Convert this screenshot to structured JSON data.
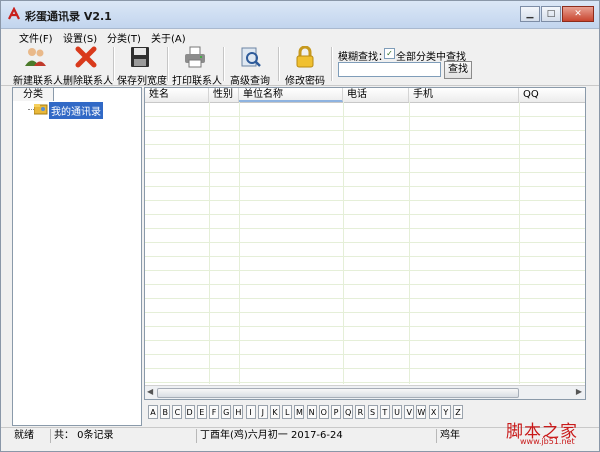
{
  "window": {
    "title": "彩蛋通讯录 V2.1",
    "controls": [
      "minimize",
      "maximize",
      "close"
    ]
  },
  "menu": [
    {
      "label": "文件(F)"
    },
    {
      "label": "设置(S)"
    },
    {
      "label": "分类(T)"
    },
    {
      "label": "关于(A)"
    }
  ],
  "toolbar": {
    "buttons": [
      {
        "label": "新建联系人",
        "icon": "new-contact-icon"
      },
      {
        "label": "删除联系人",
        "icon": "delete-contact-icon"
      },
      {
        "label": "保存列宽度",
        "icon": "save-icon"
      },
      {
        "label": "打印联系人",
        "icon": "printer-icon"
      },
      {
        "label": "高级查询",
        "icon": "advanced-search-icon"
      },
      {
        "label": "修改密码",
        "icon": "lock-icon"
      }
    ]
  },
  "search": {
    "label": "模糊查找：",
    "checkbox_label": "全部分类中查找",
    "checkbox_checked": true,
    "value": "",
    "button_label": "查找"
  },
  "sidebar": {
    "tab_label": "分类",
    "tree": [
      {
        "label": "我的通讯录",
        "selected": true
      }
    ]
  },
  "table": {
    "columns": [
      "姓名",
      "性别",
      "单位名称",
      "电话",
      "手机",
      "QQ"
    ],
    "rows": []
  },
  "alphabet": [
    "A",
    "B",
    "C",
    "D",
    "E",
    "F",
    "G",
    "H",
    "I",
    "J",
    "K",
    "L",
    "M",
    "N",
    "O",
    "P",
    "Q",
    "R",
    "S",
    "T",
    "U",
    "V",
    "W",
    "X",
    "Y",
    "Z"
  ],
  "status": {
    "state": "就绪",
    "count": "共： 0条记录",
    "date": "丁酉年(鸡)六月初一 2017-6-24",
    "zodiac": "鸡年"
  },
  "watermark": {
    "text": "脚本之家",
    "url": "www.jb51.net"
  },
  "colors": {
    "selection": "#3169c6",
    "titlebar": "#c2d5ee",
    "grid_lines": "#e5efd8",
    "watermark": "#c91a1a"
  }
}
